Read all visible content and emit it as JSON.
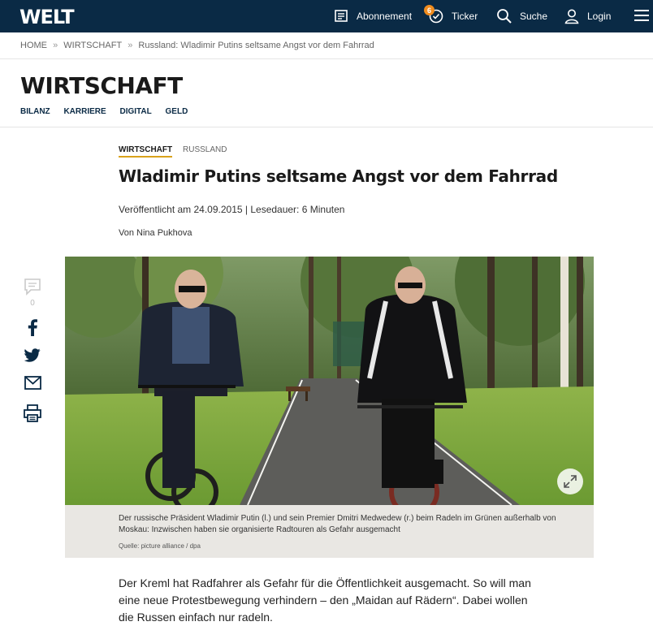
{
  "header": {
    "logo": "WELT",
    "nav": [
      {
        "label": "Abonnement",
        "icon": "newspaper-icon"
      },
      {
        "label": "Ticker",
        "icon": "ticker-clock-icon",
        "badge": "6"
      },
      {
        "label": "Suche",
        "icon": "search-icon"
      },
      {
        "label": "Login",
        "icon": "user-icon"
      }
    ],
    "menu_icon": "hamburger-menu-icon"
  },
  "breadcrumb": [
    "HOME",
    "WIRTSCHAFT",
    "Russland: Wladimir Putins seltsame Angst vor dem Fahrrad"
  ],
  "breadcrumb_separator": "»",
  "section": {
    "title": "WIRTSCHAFT",
    "subnav": [
      "BILANZ",
      "KARRIERE",
      "DIGITAL",
      "GELD"
    ]
  },
  "article": {
    "topic": "WIRTSCHAFT",
    "subtopic": "RUSSLAND",
    "headline": "Wladimir Putins seltsame Angst vor dem Fahrrad",
    "meta": "Veröffentlicht am 24.09.2015 | Lesedauer: 6 Minuten",
    "author": "Von Nina Pukhova",
    "caption": "Der russische Präsident Wladimir Putin (l.) und sein Premier Dmitri Medwedew (r.) beim Radeln im Grünen außerhalb von Moskau: Inzwischen haben sie organisierte Radtouren als Gefahr ausgemacht",
    "source": "Quelle: picture alliance / dpa",
    "lead": "Der Kreml hat Radfahrer als Gefahr für die Öffentlichkeit ausgemacht. So will man eine neue Protestbewegung verhindern – den „Maidan auf Rädern“. Dabei wollen die Russen einfach nur radeln."
  },
  "social": {
    "comment_count": "0",
    "icons": [
      "comment-icon",
      "facebook-icon",
      "twitter-icon",
      "mail-icon",
      "print-icon"
    ]
  },
  "colors": {
    "topbar": "#0a2a45",
    "accent_underline": "#d9a21b",
    "badge": "#f08c1e",
    "caption_bg": "#e9e7e3"
  }
}
